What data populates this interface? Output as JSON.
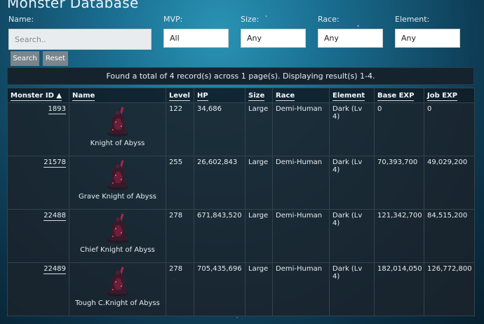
{
  "header": {
    "title": "Monster Database"
  },
  "filters": {
    "name_label": "Name:",
    "name_placeholder": "Search..",
    "mvp_label": "MVP:",
    "mvp_value": "All",
    "size_label": "Size:",
    "size_value": "Any",
    "race_label": "Race:",
    "race_value": "Any",
    "element_label": "Element:",
    "element_value": "Any",
    "search_button": "Search",
    "reset_button": "Reset"
  },
  "results_text": "Found a total of 4 record(s) across 1 page(s). Displaying result(s) 1-4.",
  "table": {
    "columns": [
      "Monster ID ▲",
      "Name",
      "Level",
      "HP",
      "Size",
      "Race",
      "Element",
      "Base EXP",
      "Job EXP"
    ],
    "rows": [
      {
        "id": "1893",
        "name": "Knight of Abyss",
        "level": "122",
        "hp": "34,686",
        "size": "Large",
        "race": "Demi-Human",
        "element": "Dark (Lv 4)",
        "base_exp": "0",
        "job_exp": "0"
      },
      {
        "id": "21578",
        "name": "Grave Knight of Abyss",
        "level": "255",
        "hp": "26,602,843",
        "size": "Large",
        "race": "Demi-Human",
        "element": "Dark (Lv 4)",
        "base_exp": "70,393,700",
        "job_exp": "49,029,200"
      },
      {
        "id": "22488",
        "name": "Chief Knight of Abyss",
        "level": "278",
        "hp": "671,843,520",
        "size": "Large",
        "race": "Demi-Human",
        "element": "Dark (Lv 4)",
        "base_exp": "121,342,700",
        "job_exp": "84,515,200"
      },
      {
        "id": "22489",
        "name": "Tough C.Knight of Abyss",
        "level": "278",
        "hp": "705,435,696",
        "size": "Large",
        "race": "Demi-Human",
        "element": "Dark (Lv 4)",
        "base_exp": "182,014,050",
        "job_exp": "126,772,800"
      }
    ]
  },
  "icons": {
    "sprite": "knight-of-abyss-sprite-icon"
  },
  "colors": {
    "sprite_dark": "#3a1a2a",
    "sprite_accent": "#b2244a",
    "button": "#7a858c"
  }
}
